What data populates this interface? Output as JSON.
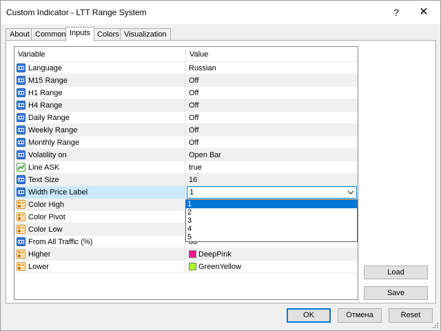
{
  "window": {
    "title": "Custom Indicator - LTT Range System",
    "help_label": "?",
    "close_label": "✕"
  },
  "tabs": [
    {
      "label": "About"
    },
    {
      "label": "Common"
    },
    {
      "label": "Inputs",
      "active": true
    },
    {
      "label": "Colors"
    },
    {
      "label": "Visualization"
    }
  ],
  "grid": {
    "col_variable": "Variable",
    "col_value": "Value",
    "rows": [
      {
        "name": "Language",
        "value": "Russian",
        "icon": "number-icon"
      },
      {
        "name": "M15 Range",
        "value": "Off",
        "icon": "number-icon"
      },
      {
        "name": "H1 Range",
        "value": "Off",
        "icon": "number-icon"
      },
      {
        "name": "H4 Range",
        "value": "Off",
        "icon": "number-icon"
      },
      {
        "name": "Daily Range",
        "value": "Off",
        "icon": "number-icon"
      },
      {
        "name": "Weekly Range",
        "value": "Off",
        "icon": "number-icon"
      },
      {
        "name": "Monthly Range",
        "value": "Off",
        "icon": "number-icon"
      },
      {
        "name": "Volatility on",
        "value": "Open Bar",
        "icon": "number-icon"
      },
      {
        "name": "Line ASK",
        "value": "true",
        "icon": "chart-line-icon"
      },
      {
        "name": "Text Size",
        "value": "16",
        "icon": "number-icon"
      },
      {
        "name": "Width Price Label",
        "value": "1",
        "icon": "number-icon"
      },
      {
        "name": "Color High",
        "value": "",
        "icon": "color-icon"
      },
      {
        "name": "Color Pivot",
        "value": "",
        "icon": "color-icon"
      },
      {
        "name": "Color Low",
        "value": "",
        "icon": "color-icon"
      },
      {
        "name": "From All Traffic (%)",
        "value": "80",
        "icon": "number-icon"
      },
      {
        "name": "Higher",
        "value": "DeepPink",
        "icon": "color-icon",
        "swatch": "#ff1493"
      },
      {
        "name": "Lower",
        "value": "GreenYellow",
        "icon": "color-icon",
        "swatch": "#adff2f"
      }
    ]
  },
  "dropdown": {
    "options": [
      "1",
      "2",
      "3",
      "4",
      "5"
    ],
    "highlighted": "1"
  },
  "side_buttons": {
    "load": "Load",
    "save": "Save"
  },
  "footer": {
    "ok": "OK",
    "cancel": "Отмена",
    "reset": "Reset"
  },
  "colors": {
    "accent": "#0078d7",
    "deep_pink": "#ff1493",
    "green_yellow": "#adff2f"
  }
}
